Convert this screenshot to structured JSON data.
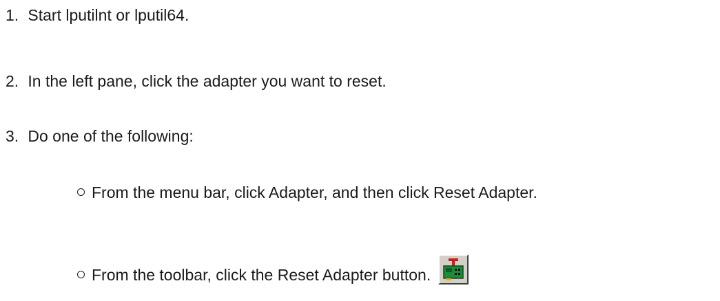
{
  "steps": [
    {
      "number": "1.",
      "text": "Start lputilnt or lputil64."
    },
    {
      "number": "2.",
      "text": "In the left pane, click the adapter you want to reset."
    },
    {
      "number": "3.",
      "text": "Do one of the following:"
    }
  ],
  "options": [
    {
      "text": "From the menu bar, click Adapter, and then click Reset Adapter."
    },
    {
      "text": "From the toolbar, click the Reset Adapter button."
    }
  ],
  "icons": {
    "bullet": "hollow-circle-bullet",
    "reset_adapter": "reset-adapter-icon"
  }
}
